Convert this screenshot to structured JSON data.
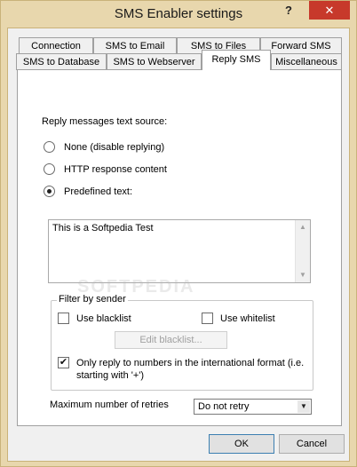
{
  "window": {
    "title": "SMS Enabler settings",
    "help_glyph": "?",
    "close_glyph": "✕"
  },
  "tabs": {
    "row1": [
      "Connection",
      "SMS to Email",
      "SMS to Files",
      "Forward SMS"
    ],
    "row2": [
      "SMS to Database",
      "SMS to Webserver",
      "Reply SMS",
      "Miscellaneous"
    ],
    "active": "Reply SMS"
  },
  "reply": {
    "source_label": "Reply messages text source:",
    "options": [
      {
        "label": "None (disable replying)",
        "checked": false
      },
      {
        "label": "HTTP response content",
        "checked": false
      },
      {
        "label": "Predefined text:",
        "checked": true
      }
    ],
    "predefined_text": "This is a Softpedia Test"
  },
  "filter": {
    "title": "Filter by sender",
    "use_blacklist": "Use blacklist",
    "use_whitelist": "Use whitelist",
    "edit_blacklist": "Edit blacklist...",
    "intl_line1": "Only reply to numbers in the international format (i.e.",
    "intl_line2": "starting with '+')",
    "intl_checked": true
  },
  "retries": {
    "label": "Maximum number of retries",
    "value": "Do not retry"
  },
  "buttons": {
    "ok": "OK",
    "cancel": "Cancel"
  },
  "watermark": "SOFTPEDIA"
}
